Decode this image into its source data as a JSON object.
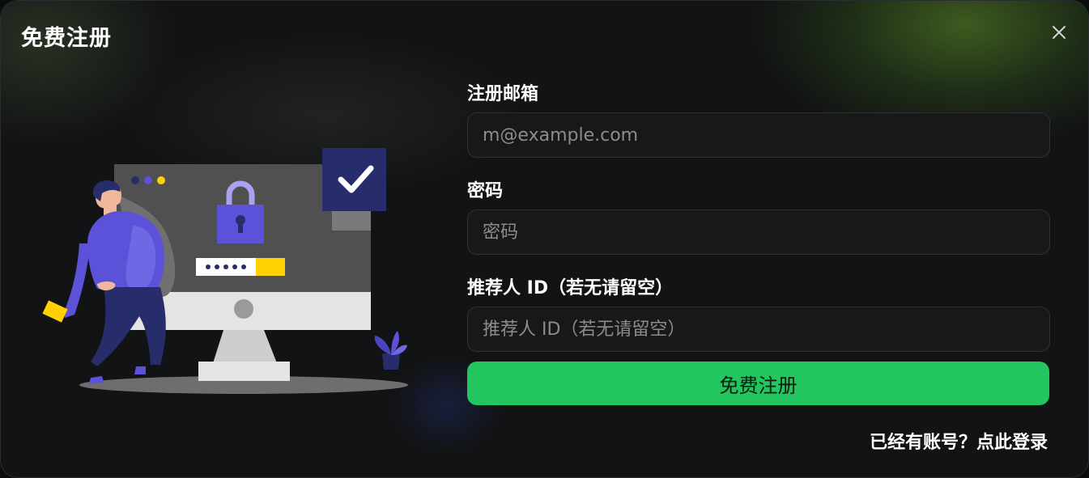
{
  "dialog": {
    "title": "免费注册"
  },
  "form": {
    "email": {
      "label": "注册邮箱",
      "placeholder": "m@example.com",
      "value": ""
    },
    "password": {
      "label": "密码",
      "placeholder": "密码",
      "value": ""
    },
    "referrer": {
      "label": "推荐人 ID（若无请留空）",
      "placeholder": "推荐人 ID（若无请留空）",
      "value": ""
    },
    "submit_label": "免费注册"
  },
  "footer": {
    "login_link": "已经有账号？点此登录"
  },
  "colors": {
    "accent": "#22c55e",
    "illustration_purple": "#5b52d9",
    "illustration_navy": "#272d6b",
    "illustration_yellow": "#ffd100"
  },
  "icons": {
    "close": "close-icon",
    "check": "checkmark-icon",
    "lock": "padlock-icon"
  }
}
